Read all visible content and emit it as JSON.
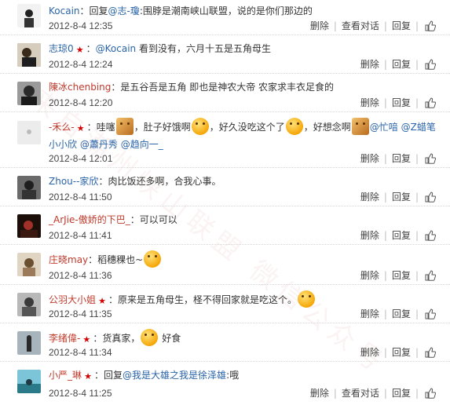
{
  "actions": {
    "delete": "删除",
    "view_conversation": "查看对话",
    "reply": "回复",
    "like_icon": "thumbs-up-icon"
  },
  "watermark": "来自潮州峡山联盟 微信公众号",
  "comments": [
    {
      "user": "Kocain",
      "badge": false,
      "text_parts": [
        "回复",
        "@志-瓊",
        ":围脖是潮南峡山联盟，说的是你们那边的"
      ],
      "time": "2012-8-4 12:35",
      "has_view": true,
      "avatar_color": "#f3f3f3"
    },
    {
      "user": "志琼0",
      "badge": true,
      "text_parts": [
        "",
        "@Kocain",
        " 看到没有，六月十五是五角母生"
      ],
      "time": "2012-8-4 12:24",
      "has_view": false,
      "avatar_color": "#5a4a3a"
    },
    {
      "user": "陳冰chenbing",
      "badge": false,
      "text_parts": [
        "是五谷吾是五角 即也是神农大帝 农家求丰衣足食的"
      ],
      "time": "2012-8-4 12:20",
      "has_view": false,
      "avatar_color": "#3a3a3a"
    },
    {
      "user": "-禾么-",
      "badge": true,
      "text_parts": [
        "哇噻",
        "，肚子好饿啊",
        "，好久没吃这个了",
        "，好想念啊",
        "@忙喑",
        "@Z蜡笔小小欣",
        "@蕭丹秀",
        "@趋向一_"
      ],
      "time": "2012-8-4 12:01",
      "has_view": false,
      "avatar_color": "#eeeeee"
    },
    {
      "user": "Zhou--家欣",
      "badge": false,
      "text_parts": [
        "肉比饭还多啊，合我心事。"
      ],
      "time": "2012-8-4 11:50",
      "has_view": false,
      "avatar_color": "#4a4a4a"
    },
    {
      "user": "_ArJie-傲娇的下巴_",
      "badge": false,
      "text_parts": [
        "可以可以"
      ],
      "time": "2012-8-4 11:41",
      "has_view": false,
      "avatar_color": "#2b1b15"
    },
    {
      "user": "庄晓may",
      "badge": false,
      "text_parts": [
        "稻穗稞也~"
      ],
      "time": "2012-8-4 11:36",
      "has_view": false,
      "avatar_color": "#c9b8a0"
    },
    {
      "user": "公羽大小姐",
      "badge": true,
      "text_parts": [
        "原来是五角母生，柽不得回家就是吃这个。"
      ],
      "time": "2012-8-4 11:35",
      "has_view": false,
      "avatar_color": "#8a8a8a"
    },
    {
      "user": "李绪偉-",
      "badge": true,
      "text_parts": [
        "货真家，",
        " 好食"
      ],
      "time": "2012-8-4 11:34",
      "has_view": false,
      "avatar_color": "#7a8a95"
    },
    {
      "user": "小严_琳",
      "badge": true,
      "text_parts": [
        "回复",
        "@我是大雄之我是徐泽雄",
        ":哦"
      ],
      "time": "2012-8-4 11:25",
      "has_view": true,
      "avatar_color": "#3d8fa3"
    }
  ]
}
